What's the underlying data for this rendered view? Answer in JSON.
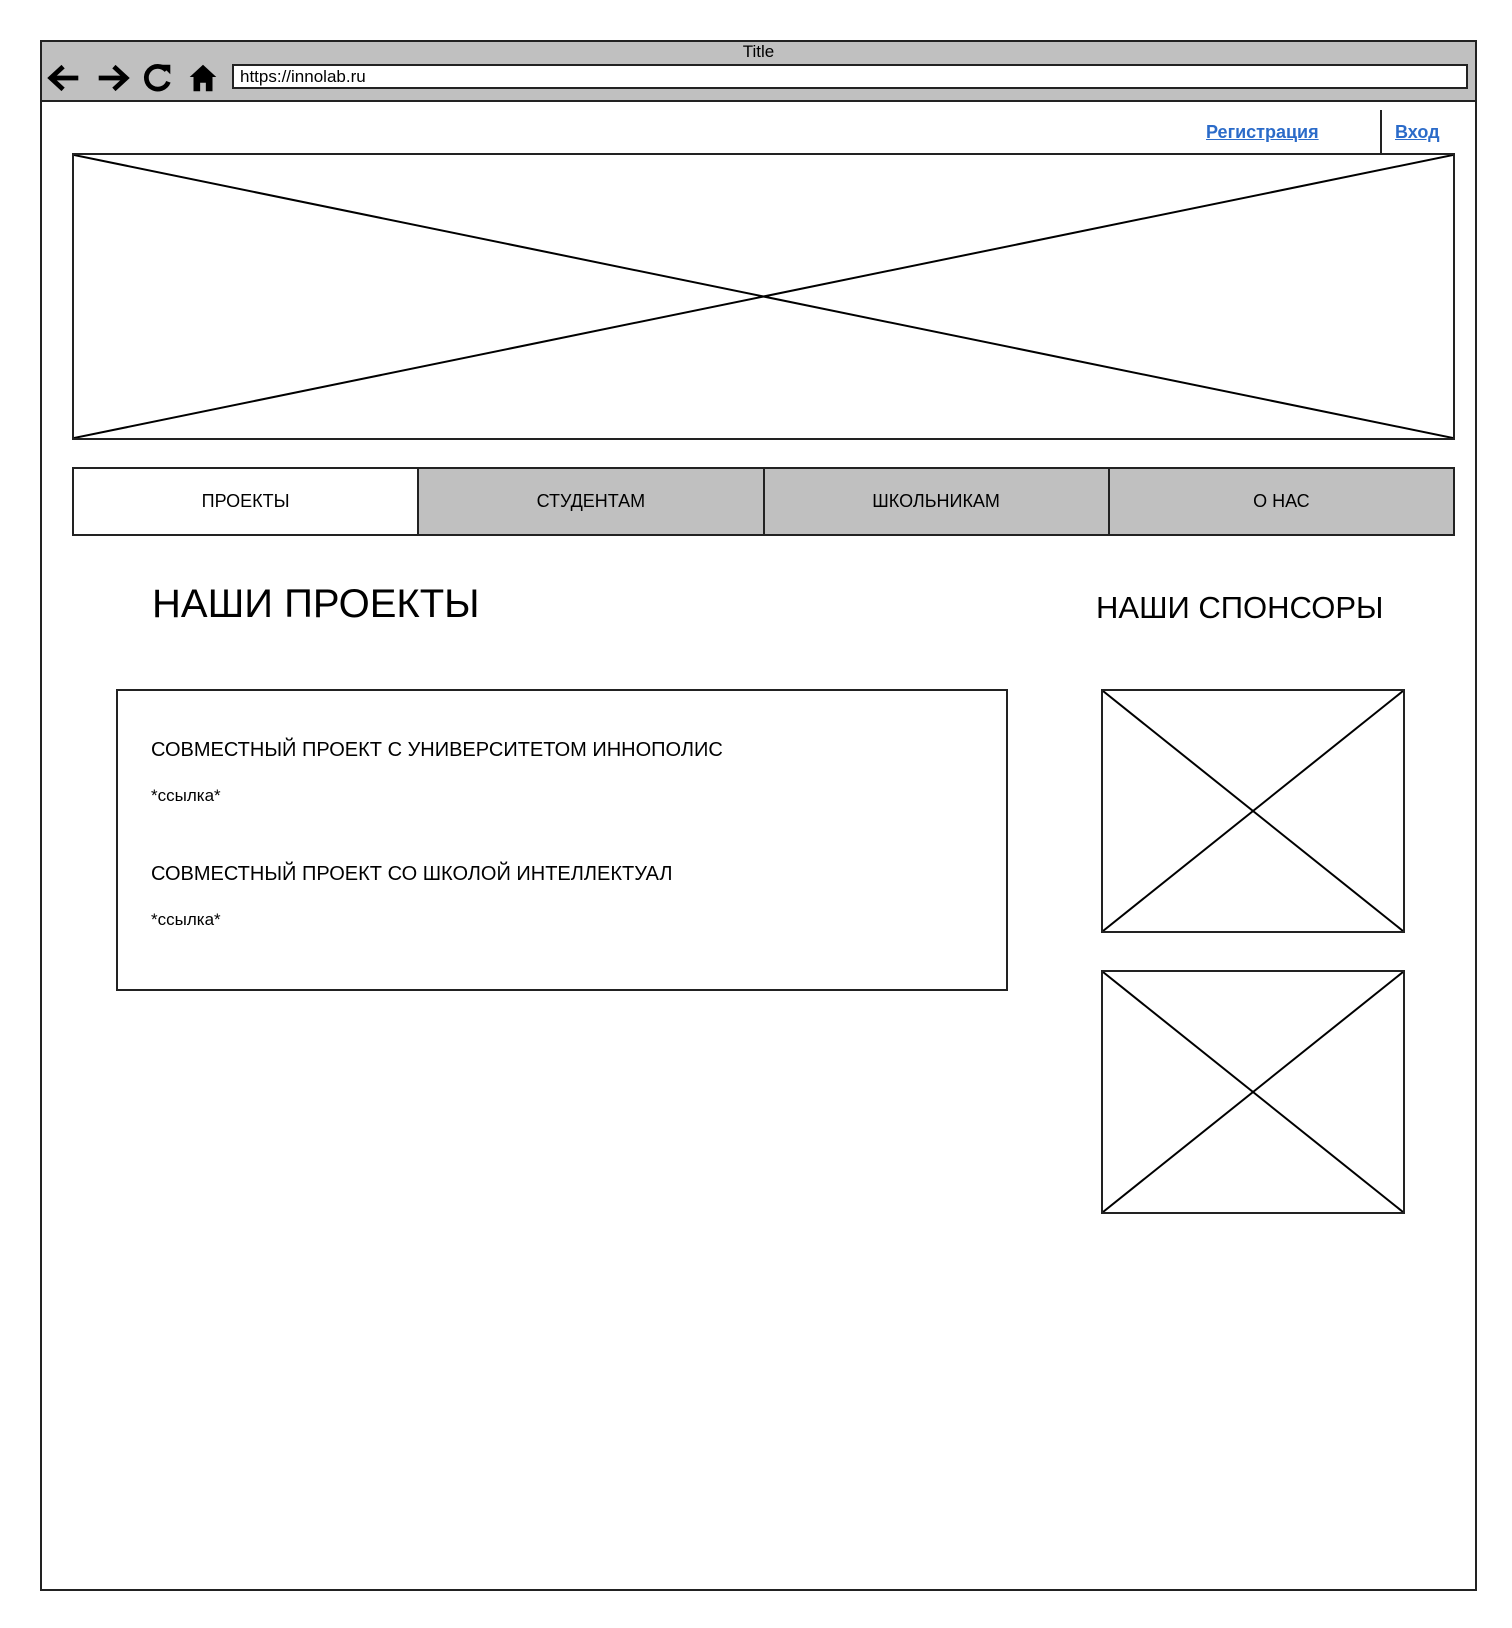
{
  "window": {
    "title": "Title",
    "url": "https://innolab.ru"
  },
  "toolbar": {
    "back_icon": "arrow-left-icon",
    "forward_icon": "arrow-right-icon",
    "reload_icon": "reload-icon",
    "home_icon": "home-icon"
  },
  "auth": {
    "register_label": "Регистрация",
    "login_label": "Вход",
    "link_color": "#2b6bc9"
  },
  "tabs": [
    {
      "label": "ПРОЕКТЫ",
      "active": true
    },
    {
      "label": "СТУДЕНТАМ",
      "active": false
    },
    {
      "label": "ШКОЛЬНИКАМ",
      "active": false
    },
    {
      "label": "О НАС",
      "active": false
    }
  ],
  "projects": {
    "heading": "НАШИ ПРОЕКТЫ",
    "items": [
      {
        "title": "СОВМЕСТНЫЙ ПРОЕКТ С УНИВЕРСИТЕТОМ ИННОПОЛИС",
        "link": "*ссылка*"
      },
      {
        "title": "СОВМЕСТНЫЙ ПРОЕКТ СО ШКОЛОЙ ИНТЕЛЛЕКТУАЛ",
        "link": "*ссылка*"
      }
    ]
  },
  "sponsors": {
    "heading": "НАШИ СПОНСОРЫ"
  },
  "colors": {
    "chrome_bg": "#c0c0c0",
    "tab_inactive_bg": "#c0c0c0",
    "border": "#222222"
  }
}
